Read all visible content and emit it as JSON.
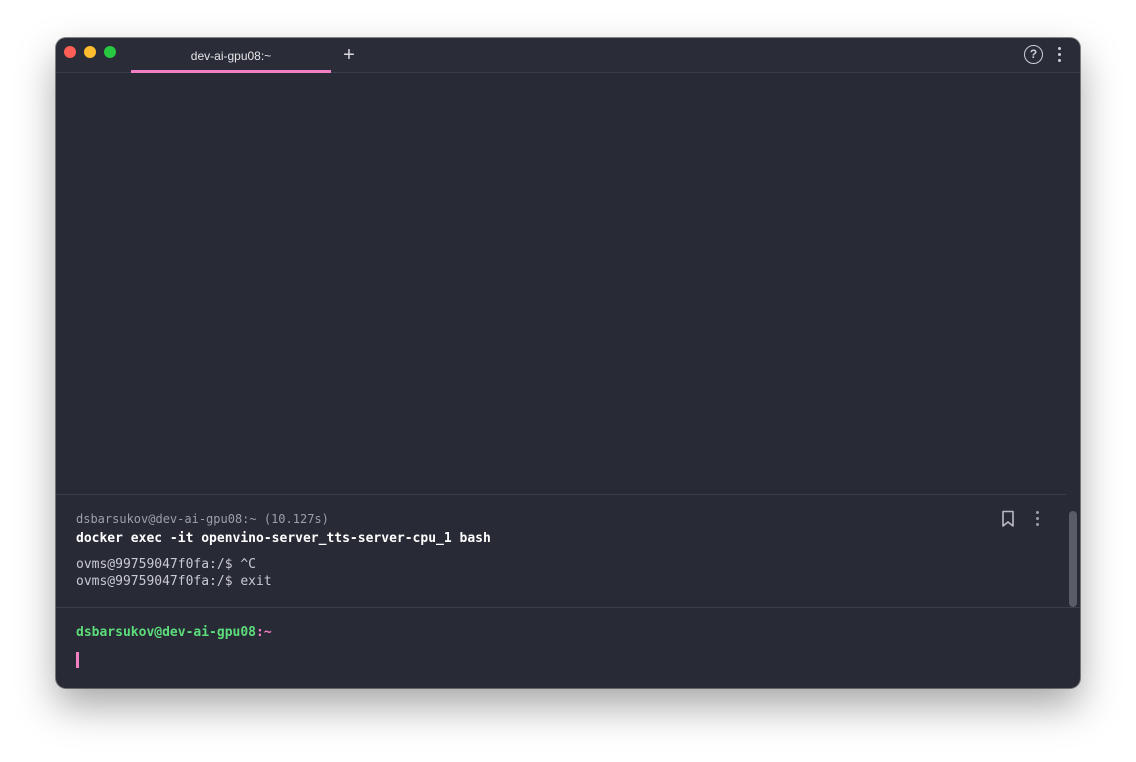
{
  "tab": {
    "title": "dev-ai-gpu08:~",
    "new_tab_symbol": "+"
  },
  "toolbar": {
    "help_symbol": "?"
  },
  "block": {
    "meta": "dsbarsukov@dev-ai-gpu08:~ (10.127s)",
    "command": "docker exec -it openvino-server_tts-server-cpu_1 bash",
    "output": [
      "ovms@99759047f0fa:/$ ^C",
      "ovms@99759047f0fa:/$ exit"
    ]
  },
  "prompt": {
    "user_host": "dsbarsukov@dev-ai-gpu08",
    "path": ":~"
  },
  "colors": {
    "background": "#282a36",
    "accent": "#f27ec3",
    "prompt_green": "#5cdc7a",
    "close": "#ff5f57",
    "minimize": "#febc2e",
    "maximize": "#28c840"
  },
  "icons": [
    "close-icon",
    "minimize-icon",
    "maximize-icon",
    "plus-icon",
    "help-icon",
    "more-vertical-icon",
    "bookmark-icon"
  ]
}
